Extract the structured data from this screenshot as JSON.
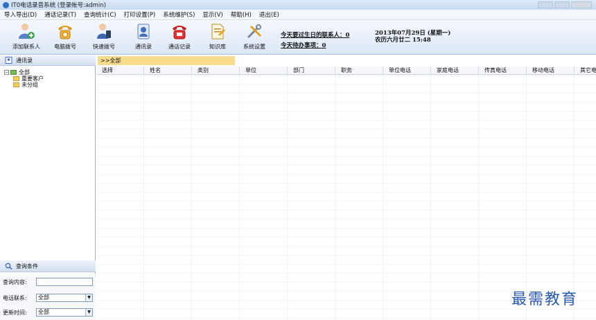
{
  "window": {
    "title": "IT0电话录音系统 (登录帐号:admin)"
  },
  "menu": [
    "导入导出(D)",
    "通话记录(T)",
    "查询统计(C)",
    "打印设置(P)",
    "系统维护(S)",
    "显示(V)",
    "帮助(H)",
    "退出(E)"
  ],
  "toolbar": {
    "items": [
      {
        "label": "添加联系人",
        "icon": "add-contact-icon"
      },
      {
        "label": "电脑拨号",
        "icon": "phone-dial-icon"
      },
      {
        "label": "快速拨号",
        "icon": "quick-dial-icon"
      },
      {
        "label": "通讯录",
        "icon": "address-book-icon"
      },
      {
        "label": "通话记录",
        "icon": "call-log-icon"
      },
      {
        "label": "知识库",
        "icon": "knowledge-base-icon"
      },
      {
        "label": "系统设置",
        "icon": "settings-icon"
      }
    ],
    "notices": {
      "birthdays": "今天要过生日的联系人：0",
      "todos": "今天待办事项：0"
    },
    "date_line1": "2013年07月29日 (星期一)",
    "date_line2": "农历六月廿二   15:48"
  },
  "left_panel": {
    "header": "通讯录",
    "tree": {
      "root": "全部",
      "children": [
        "重要客户",
        "未分组"
      ]
    },
    "query": {
      "header": "查询条件",
      "content_label": "查询内容:",
      "phone_label": "电话联系:",
      "phone_value": "全部",
      "update_label": "更新时间:",
      "update_value": "全部"
    }
  },
  "main": {
    "breadcrumb": ">>全部",
    "columns": [
      "选择",
      "姓名",
      "类别",
      "单位",
      "部门",
      "职务",
      "单位电话",
      "家庭电话",
      "传真电话",
      "移动电话",
      "其它电"
    ]
  },
  "watermark": "最需教育",
  "colors": {
    "accent": "#2a5bb0",
    "crumb": "#f7dc8e",
    "toolbar_top": "#f6f9fd",
    "toolbar_bottom": "#dbe7f6"
  }
}
